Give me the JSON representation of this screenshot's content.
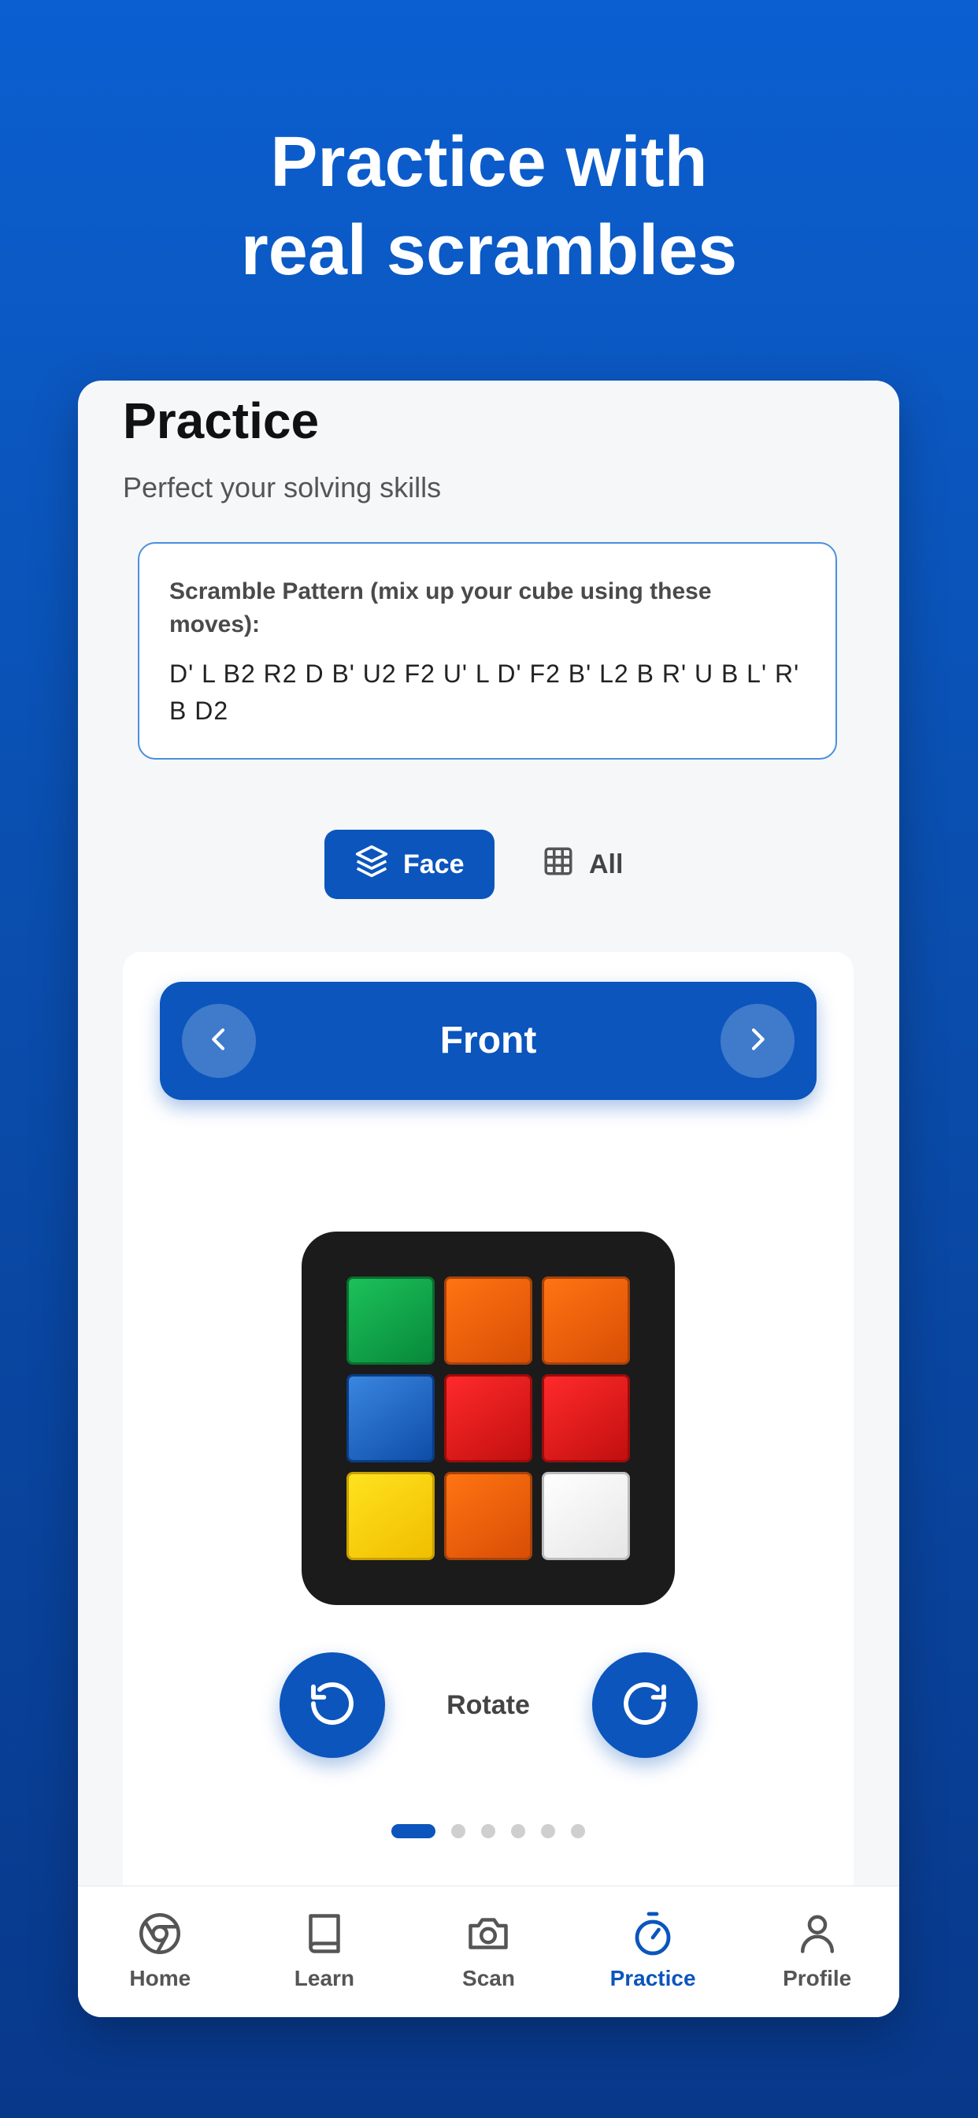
{
  "headline": {
    "line1": "Practice with",
    "line2": "real scrambles"
  },
  "page": {
    "title": "Practice",
    "subtitle": "Perfect your solving skills"
  },
  "scramble": {
    "label": "Scramble Pattern (mix up your cube using these moves):",
    "moves": "D' L B2 R2 D B' U2 F2 U' L D' F2 B' L2 B R' U B L' R' B D2"
  },
  "view_toggle": {
    "face_label": "Face",
    "all_label": "All",
    "selected": "Face"
  },
  "face_header": {
    "title": "Front"
  },
  "cube_face": {
    "stickers": [
      "green",
      "orange",
      "orange",
      "blue",
      "red",
      "red",
      "yellow",
      "orange",
      "white"
    ]
  },
  "rotate": {
    "label": "Rotate"
  },
  "pager": {
    "pages": 6,
    "current": 1
  },
  "tabbar": {
    "items": [
      {
        "label": "Home",
        "icon": "chrome-icon"
      },
      {
        "label": "Learn",
        "icon": "book-icon"
      },
      {
        "label": "Scan",
        "icon": "camera-icon"
      },
      {
        "label": "Practice",
        "icon": "timer-icon"
      },
      {
        "label": "Profile",
        "icon": "user-icon"
      }
    ],
    "active": "Practice"
  },
  "colors": {
    "accent": "#0b55bd",
    "background_top": "#0b5fd0",
    "background_bottom": "#08388a",
    "green": "#0ea84a",
    "orange": "#f0620a",
    "blue": "#1a66c8",
    "red": "#e01b1b",
    "yellow": "#f5cf0a",
    "white": "#f4f4f4"
  }
}
